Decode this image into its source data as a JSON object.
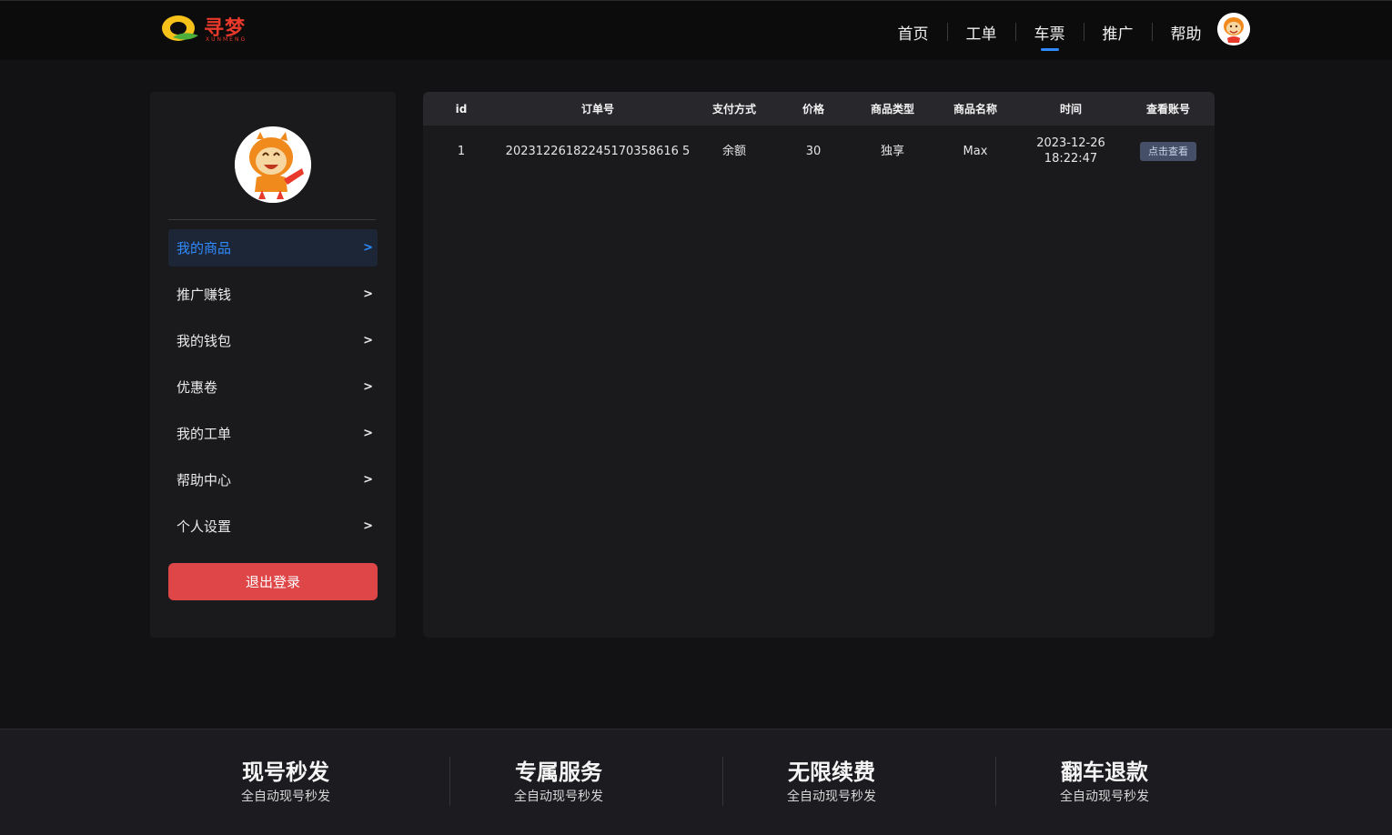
{
  "brand": {
    "name": "寻梦",
    "sub": "XUNMENG"
  },
  "nav": {
    "items": [
      {
        "label": "首页"
      },
      {
        "label": "工单"
      },
      {
        "label": "车票",
        "active": true
      },
      {
        "label": "推广"
      },
      {
        "label": "帮助"
      }
    ]
  },
  "sidebar": {
    "items": [
      {
        "label": "我的商品",
        "active": true
      },
      {
        "label": "推广赚钱"
      },
      {
        "label": "我的钱包"
      },
      {
        "label": "优惠卷"
      },
      {
        "label": "我的工单"
      },
      {
        "label": "帮助中心"
      },
      {
        "label": "个人设置"
      }
    ],
    "chevron": ">",
    "logout_label": "退出登录"
  },
  "table": {
    "headers": [
      "id",
      "订单号",
      "支付方式",
      "价格",
      "商品类型",
      "商品名称",
      "时间",
      "查看账号"
    ],
    "rows": [
      {
        "id": "1",
        "order_no": "20231226182245170358616 5",
        "pay_method": "余额",
        "price": "30",
        "product_type": "独享",
        "product_name": "Max",
        "time_date": "2023-12-26",
        "time_clock": "18:22:47",
        "action_label": "点击查看"
      }
    ]
  },
  "footer": {
    "features": [
      {
        "title": "现号秒发",
        "sub": "全自动现号秒发"
      },
      {
        "title": "专属服务",
        "sub": "全自动现号秒发"
      },
      {
        "title": "无限续费",
        "sub": "全自动现号秒发"
      },
      {
        "title": "翻车退款",
        "sub": "全自动现号秒发"
      }
    ]
  },
  "colors": {
    "accent": "#2f8bff",
    "logout": "#df4648",
    "brand": "#e8392b"
  }
}
